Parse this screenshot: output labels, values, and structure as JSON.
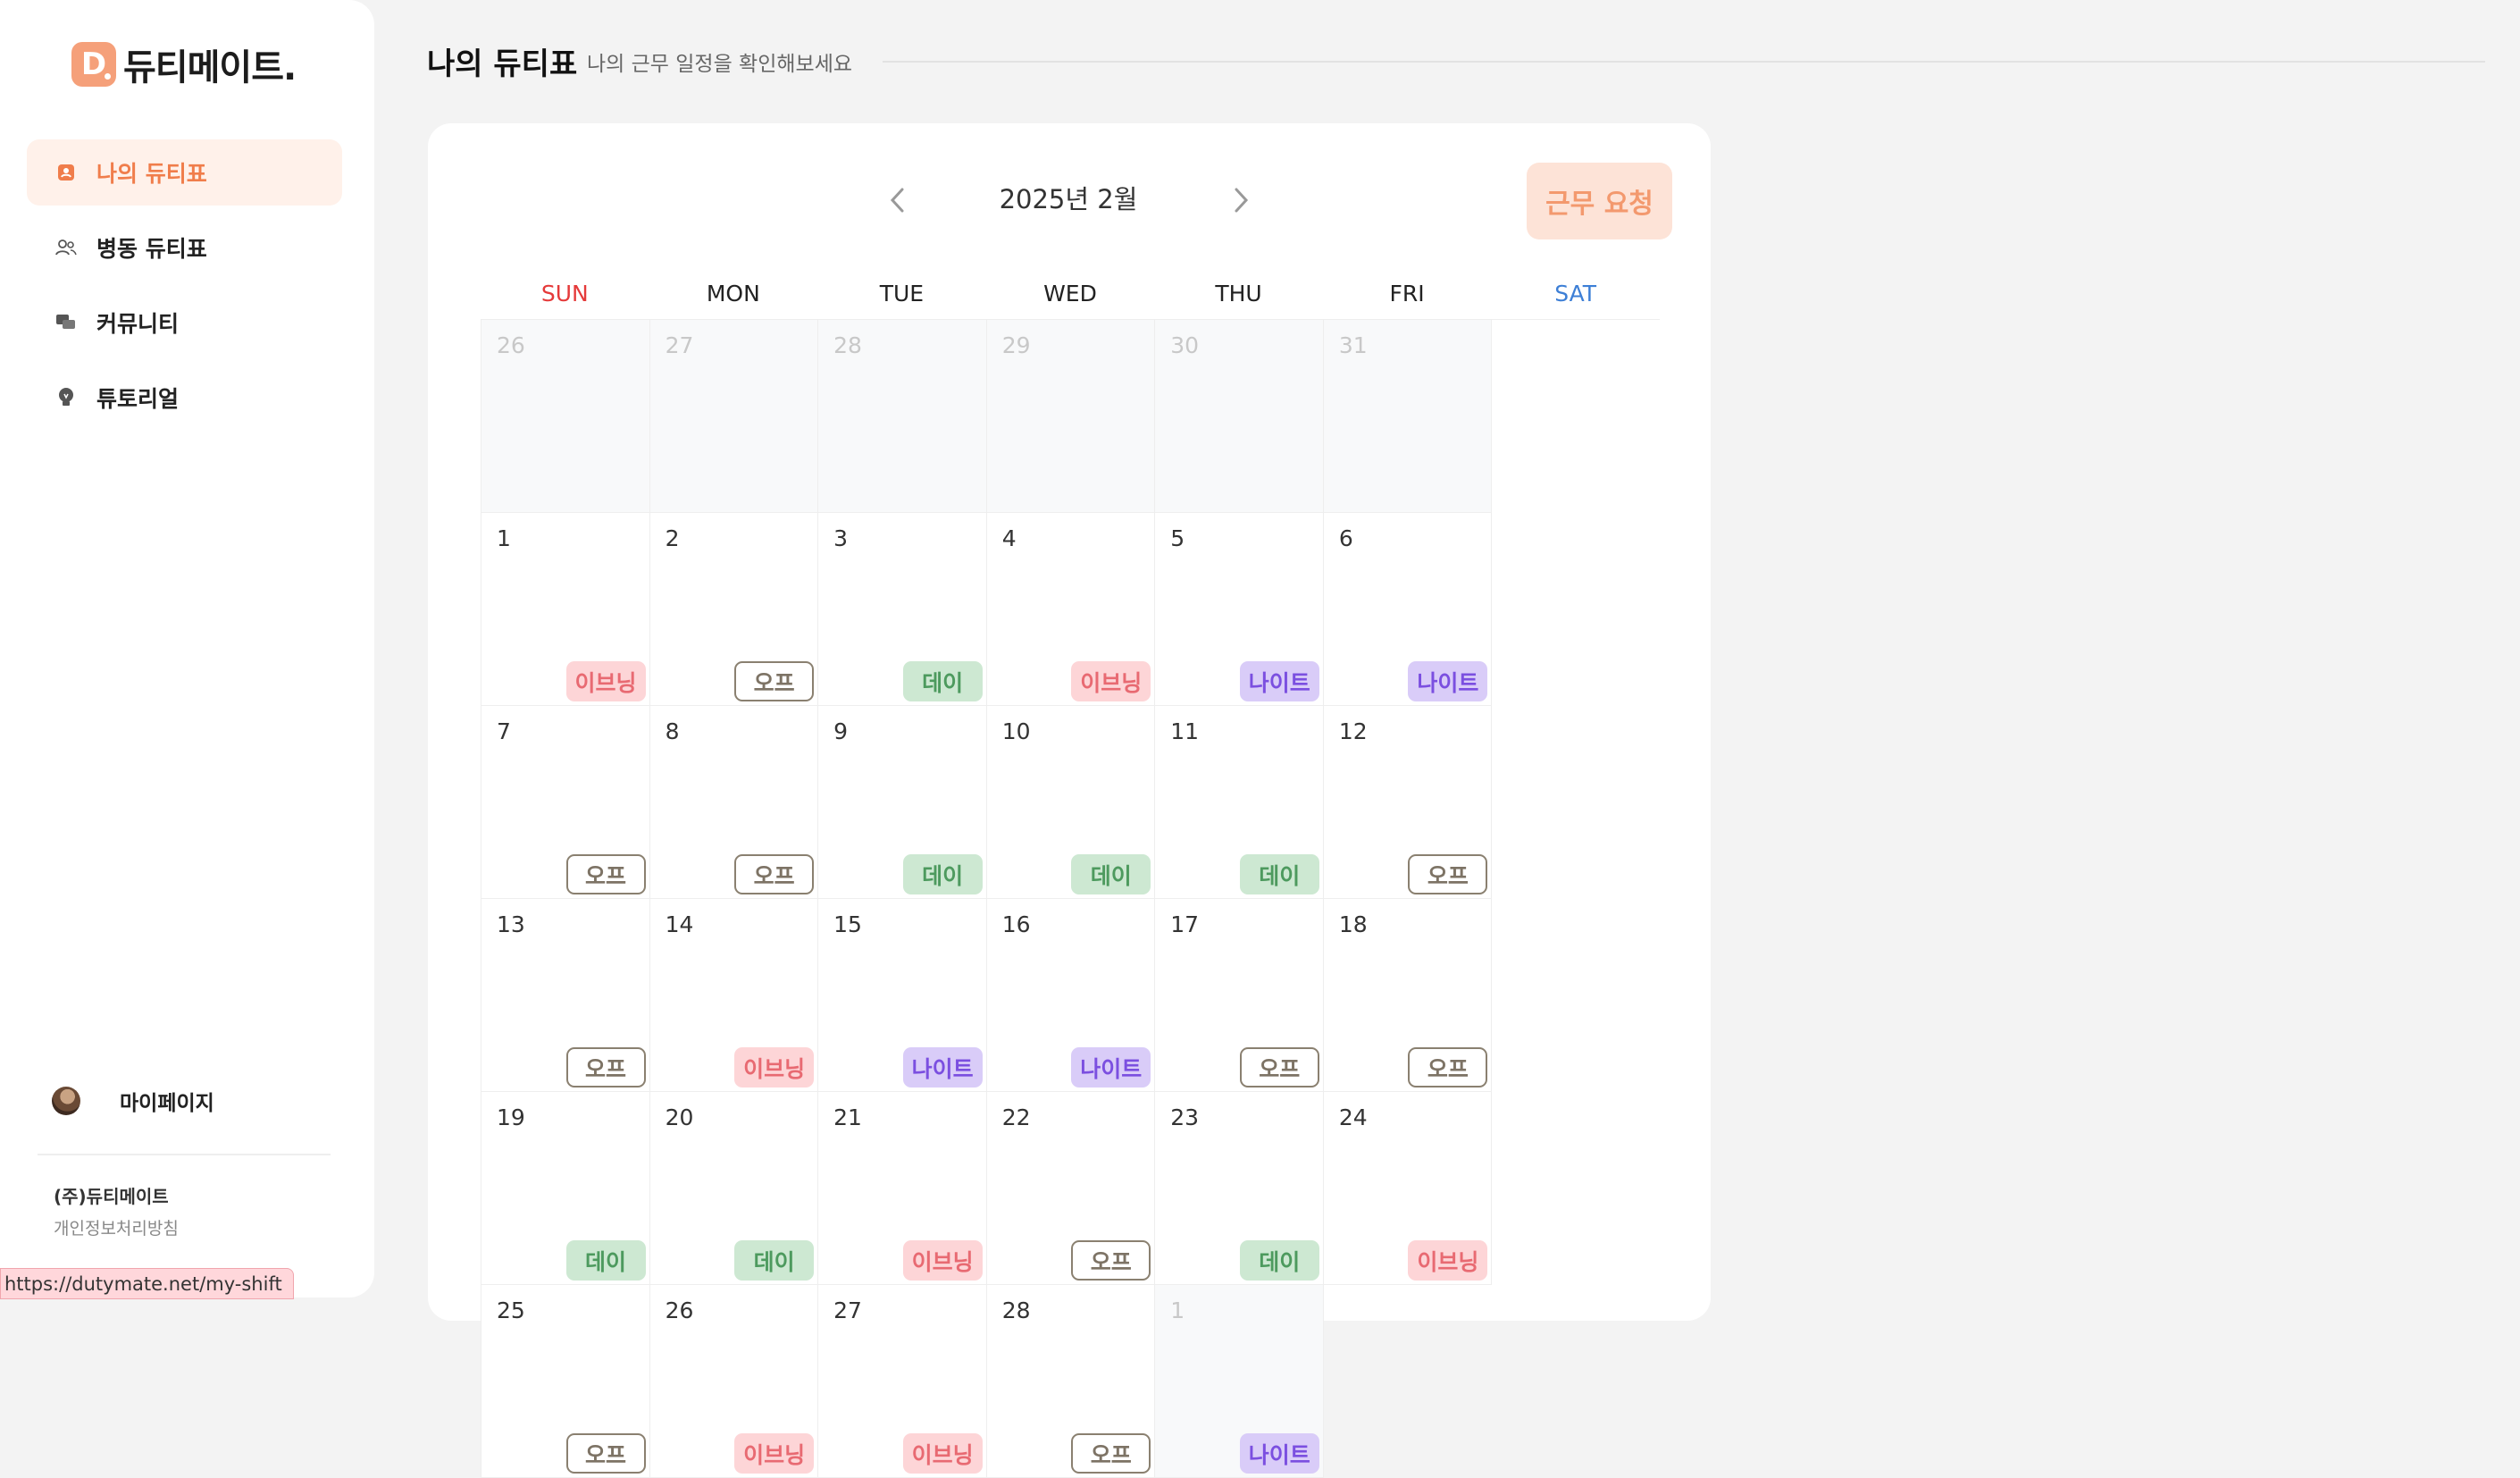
{
  "brand": {
    "mark": "D",
    "name": "듀티메이트."
  },
  "nav": [
    {
      "label": "나의 듀티표",
      "icon": "badge-icon",
      "active": true
    },
    {
      "label": "병동 듀티표",
      "icon": "users-icon",
      "active": false
    },
    {
      "label": "커뮤니티",
      "icon": "chat-bubbles-icon",
      "active": false
    },
    {
      "label": "튜토리얼",
      "icon": "lightbulb-icon",
      "active": false
    }
  ],
  "mypage": {
    "label": "마이페이지"
  },
  "footer": {
    "company": "(주)듀티메이트",
    "privacy": "개인정보처리방침"
  },
  "status_url": "https://dutymate.net/my-shift",
  "header": {
    "title": "나의 듀티표",
    "subtitle": "나의 근무 일정을 확인해보세요"
  },
  "calendar": {
    "month_label": "2025년 2월",
    "request_button": "근무 요청",
    "weekdays": [
      "SUN",
      "MON",
      "TUE",
      "WED",
      "THU",
      "FRI",
      "SAT"
    ],
    "days": [
      {
        "d": "26",
        "dim": true,
        "shift": ""
      },
      {
        "d": "27",
        "dim": true,
        "shift": ""
      },
      {
        "d": "28",
        "dim": true,
        "shift": ""
      },
      {
        "d": "29",
        "dim": true,
        "shift": ""
      },
      {
        "d": "30",
        "dim": true,
        "shift": ""
      },
      {
        "d": "31",
        "dim": true,
        "shift": ""
      },
      {
        "d": "1",
        "dim": false,
        "shift": "이브닝"
      },
      {
        "d": "2",
        "dim": false,
        "shift": "오프"
      },
      {
        "d": "3",
        "dim": false,
        "shift": "데이"
      },
      {
        "d": "4",
        "dim": false,
        "shift": "이브닝"
      },
      {
        "d": "5",
        "dim": false,
        "shift": "나이트"
      },
      {
        "d": "6",
        "dim": false,
        "shift": "나이트"
      },
      {
        "d": "7",
        "dim": false,
        "shift": "오프"
      },
      {
        "d": "8",
        "dim": false,
        "shift": "오프"
      },
      {
        "d": "9",
        "dim": false,
        "shift": "데이"
      },
      {
        "d": "10",
        "dim": false,
        "shift": "데이"
      },
      {
        "d": "11",
        "dim": false,
        "shift": "데이"
      },
      {
        "d": "12",
        "dim": false,
        "shift": "오프"
      },
      {
        "d": "13",
        "dim": false,
        "shift": "오프"
      },
      {
        "d": "14",
        "dim": false,
        "shift": "이브닝"
      },
      {
        "d": "15",
        "dim": false,
        "shift": "나이트"
      },
      {
        "d": "16",
        "dim": false,
        "shift": "나이트"
      },
      {
        "d": "17",
        "dim": false,
        "shift": "오프"
      },
      {
        "d": "18",
        "dim": false,
        "shift": "오프"
      },
      {
        "d": "19",
        "dim": false,
        "shift": "데이"
      },
      {
        "d": "20",
        "dim": false,
        "shift": "데이"
      },
      {
        "d": "21",
        "dim": false,
        "shift": "이브닝"
      },
      {
        "d": "22",
        "dim": false,
        "shift": "오프"
      },
      {
        "d": "23",
        "dim": false,
        "shift": "데이"
      },
      {
        "d": "24",
        "dim": false,
        "shift": "이브닝"
      },
      {
        "d": "25",
        "dim": false,
        "shift": "오프"
      },
      {
        "d": "26",
        "dim": false,
        "shift": "이브닝"
      },
      {
        "d": "27",
        "dim": false,
        "shift": "이브닝"
      },
      {
        "d": "28",
        "dim": false,
        "shift": "오프"
      },
      {
        "d": "1",
        "dim": true,
        "shift": "나이트"
      }
    ]
  },
  "colors": {
    "accent": "#f07d4b",
    "off": "#7d7365",
    "day": "#4d9a5e",
    "evening": "#e86a72",
    "night": "#7b4fe0"
  }
}
